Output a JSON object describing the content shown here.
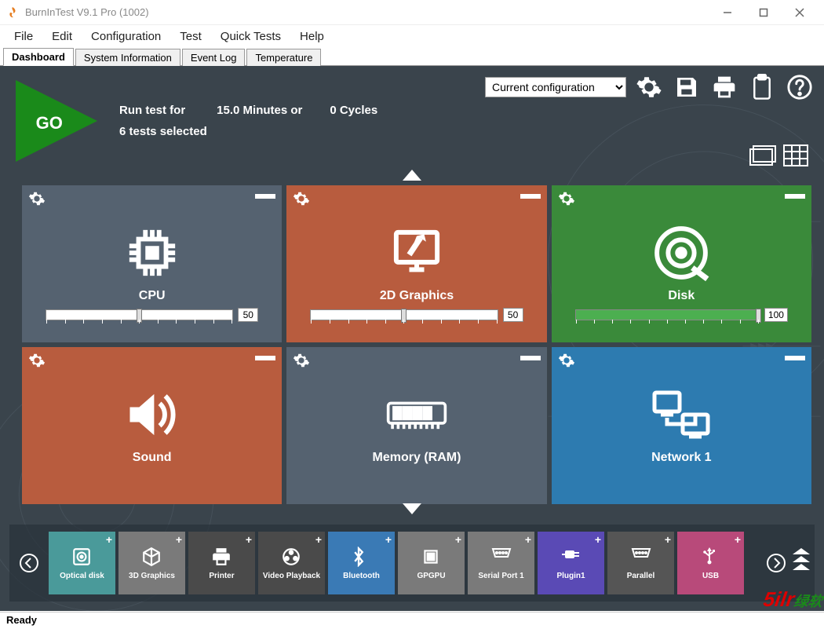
{
  "window": {
    "title": "BurnInTest V9.1 Pro (1002)"
  },
  "menu": {
    "items": [
      "File",
      "Edit",
      "Configuration",
      "Test",
      "Quick Tests",
      "Help"
    ]
  },
  "tabs": {
    "items": [
      "Dashboard",
      "System Information",
      "Event Log",
      "Temperature"
    ],
    "active": 0
  },
  "go": {
    "label": "GO"
  },
  "run_info": {
    "run_for_label": "Run test for",
    "minutes": "15.0 Minutes or",
    "cycles": "0 Cycles",
    "selected": "6 tests selected"
  },
  "toolbar": {
    "config_select": "Current configuration",
    "icons": [
      "settings",
      "save",
      "print",
      "clipboard",
      "help"
    ]
  },
  "tiles": [
    {
      "id": "cpu",
      "label": "CPU",
      "value": "50",
      "fill": 50,
      "color": "tile-cpu"
    },
    {
      "id": "2d",
      "label": "2D Graphics",
      "value": "50",
      "fill": 50,
      "color": "tile-2d"
    },
    {
      "id": "disk",
      "label": "Disk",
      "value": "100",
      "fill": 100,
      "color": "tile-disk"
    },
    {
      "id": "sound",
      "label": "Sound",
      "value": "",
      "fill": 0,
      "color": "tile-sound"
    },
    {
      "id": "mem",
      "label": "Memory (RAM)",
      "value": "",
      "fill": 0,
      "color": "tile-mem"
    },
    {
      "id": "net",
      "label": "Network 1",
      "value": "",
      "fill": 0,
      "color": "tile-net"
    }
  ],
  "mini_tiles": [
    {
      "label": "Optical disk",
      "color": "mt-teal",
      "icon": "disc"
    },
    {
      "label": "3D Graphics",
      "color": "mt-gray",
      "icon": "cube"
    },
    {
      "label": "Printer",
      "color": "mt-dark",
      "icon": "print"
    },
    {
      "label": "Video Playback",
      "color": "mt-dark",
      "icon": "film"
    },
    {
      "label": "Bluetooth",
      "color": "mt-blue",
      "icon": "bt"
    },
    {
      "label": "GPGPU",
      "color": "mt-gray",
      "icon": "chip"
    },
    {
      "label": "Serial Port 1",
      "color": "mt-gray",
      "icon": "serial"
    },
    {
      "label": "Plugin1",
      "color": "mt-purple",
      "icon": "plug"
    },
    {
      "label": "Parallel",
      "color": "mt-dgray",
      "icon": "serial"
    },
    {
      "label": "USB",
      "color": "mt-pink",
      "icon": "usb"
    }
  ],
  "status": {
    "text": "Ready"
  },
  "watermark": {
    "main": "5ilr",
    "sub": "绿软"
  }
}
